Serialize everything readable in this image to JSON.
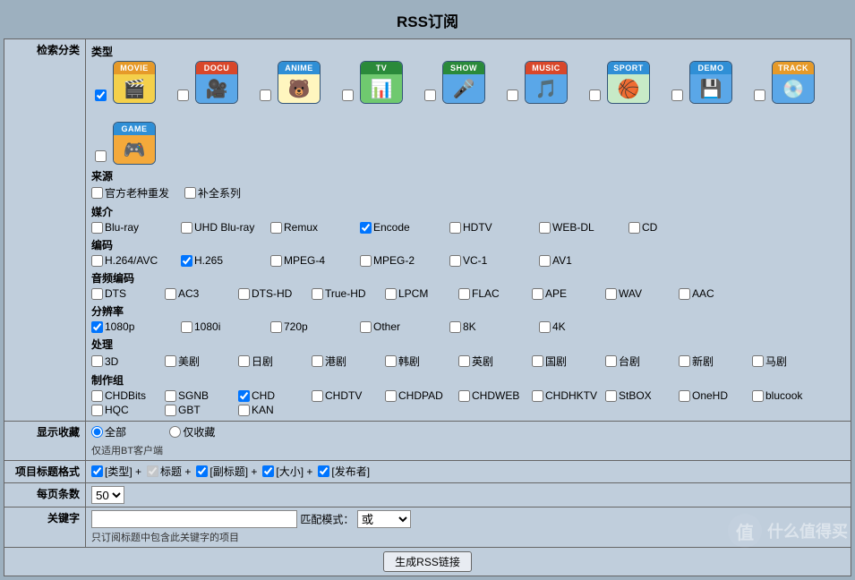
{
  "title": "RSS订阅",
  "labels": {
    "search_cat": "检索分类",
    "show_fav": "显示收藏",
    "title_fmt": "项目标题格式",
    "per_page": "每页条数",
    "keyword": "关键字"
  },
  "heads": {
    "type": "类型",
    "source": "来源",
    "media": "媒介",
    "codec": "编码",
    "audio": "音频编码",
    "res": "分辨率",
    "process": "处理",
    "team": "制作组"
  },
  "categories": [
    {
      "label": "MOVIE",
      "banner": "#e69a29",
      "bg": "#f4d04b",
      "glyph": "🎬",
      "checked": true
    },
    {
      "label": "DOCU",
      "banner": "#d9472a",
      "bg": "#5aa7e8",
      "glyph": "🎥",
      "checked": false
    },
    {
      "label": "ANIME",
      "banner": "#2f8fd6",
      "bg": "#fff6bf",
      "glyph": "🐻",
      "checked": false
    },
    {
      "label": "TV",
      "banner": "#2a8a3a",
      "bg": "#6fc96f",
      "glyph": "📊",
      "checked": false
    },
    {
      "label": "SHOW",
      "banner": "#2a8a3a",
      "bg": "#5aa7e8",
      "glyph": "🎤",
      "checked": false
    },
    {
      "label": "MUSIC",
      "banner": "#d9472a",
      "bg": "#5aa7e8",
      "glyph": "🎵",
      "checked": false
    },
    {
      "label": "SPORT",
      "banner": "#2f8fd6",
      "bg": "#c7eac7",
      "glyph": "🏀",
      "checked": false
    },
    {
      "label": "DEMO",
      "banner": "#2f8fd6",
      "bg": "#5aa7e8",
      "glyph": "💾",
      "checked": false
    },
    {
      "label": "TRACK",
      "banner": "#e69a29",
      "bg": "#5aa7e8",
      "glyph": "💿",
      "checked": false
    },
    {
      "label": "GAME",
      "banner": "#2f8fd6",
      "bg": "#f4a93b",
      "glyph": "🎮",
      "checked": false
    }
  ],
  "source": [
    {
      "label": "官方老种重发",
      "checked": false
    },
    {
      "label": "补全系列",
      "checked": false
    }
  ],
  "media": [
    {
      "label": "Blu-ray",
      "checked": false
    },
    {
      "label": "UHD Blu-ray",
      "checked": false
    },
    {
      "label": "Remux",
      "checked": false
    },
    {
      "label": "Encode",
      "checked": true
    },
    {
      "label": "HDTV",
      "checked": false
    },
    {
      "label": "WEB-DL",
      "checked": false
    },
    {
      "label": "CD",
      "checked": false
    }
  ],
  "codec": [
    {
      "label": "H.264/AVC",
      "checked": false
    },
    {
      "label": "H.265",
      "checked": true
    },
    {
      "label": "MPEG-4",
      "checked": false
    },
    {
      "label": "MPEG-2",
      "checked": false
    },
    {
      "label": "VC-1",
      "checked": false
    },
    {
      "label": "AV1",
      "checked": false
    }
  ],
  "audio": [
    {
      "label": "DTS",
      "checked": false
    },
    {
      "label": "AC3",
      "checked": false
    },
    {
      "label": "DTS-HD",
      "checked": false
    },
    {
      "label": "True-HD",
      "checked": false
    },
    {
      "label": "LPCM",
      "checked": false
    },
    {
      "label": "FLAC",
      "checked": false
    },
    {
      "label": "APE",
      "checked": false
    },
    {
      "label": "WAV",
      "checked": false
    },
    {
      "label": "AAC",
      "checked": false
    }
  ],
  "res": [
    {
      "label": "1080p",
      "checked": true
    },
    {
      "label": "1080i",
      "checked": false
    },
    {
      "label": "720p",
      "checked": false
    },
    {
      "label": "Other",
      "checked": false
    },
    {
      "label": "8K",
      "checked": false
    },
    {
      "label": "4K",
      "checked": false
    }
  ],
  "process": [
    {
      "label": "3D",
      "checked": false
    },
    {
      "label": "美剧",
      "checked": false
    },
    {
      "label": "日剧",
      "checked": false
    },
    {
      "label": "港剧",
      "checked": false
    },
    {
      "label": "韩剧",
      "checked": false
    },
    {
      "label": "英剧",
      "checked": false
    },
    {
      "label": "国剧",
      "checked": false
    },
    {
      "label": "台剧",
      "checked": false
    },
    {
      "label": "新剧",
      "checked": false
    },
    {
      "label": "马剧",
      "checked": false
    }
  ],
  "team": [
    {
      "label": "CHDBits",
      "checked": false
    },
    {
      "label": "SGNB",
      "checked": false
    },
    {
      "label": "CHD",
      "checked": true
    },
    {
      "label": "CHDTV",
      "checked": false
    },
    {
      "label": "CHDPAD",
      "checked": false
    },
    {
      "label": "CHDWEB",
      "checked": false
    },
    {
      "label": "CHDHKTV",
      "checked": false
    },
    {
      "label": "StBOX",
      "checked": false
    },
    {
      "label": "OneHD",
      "checked": false
    },
    {
      "label": "blucook",
      "checked": false
    },
    {
      "label": "HQC",
      "checked": false
    },
    {
      "label": "GBT",
      "checked": false
    },
    {
      "label": "KAN",
      "checked": false
    }
  ],
  "fav": {
    "all": "全部",
    "only": "仅收藏",
    "note": "仅适用BT客户端",
    "all_checked": true
  },
  "title_fmt": [
    {
      "label": "[类型]",
      "plus": "+",
      "checked": true,
      "disabled": false
    },
    {
      "label": "标题",
      "plus": "+",
      "checked": true,
      "disabled": true
    },
    {
      "label": "[副标题]",
      "plus": "+",
      "checked": true,
      "disabled": false
    },
    {
      "label": "[大小]",
      "plus": "+",
      "checked": true,
      "disabled": false
    },
    {
      "label": "[发布者]",
      "plus": "",
      "checked": true,
      "disabled": false
    }
  ],
  "per_page_options": [
    "50"
  ],
  "per_page_selected": "50",
  "keyword": {
    "match_label": "匹配模式：",
    "mode": "或",
    "note": "只订阅标题中包含此关键字的项目"
  },
  "submit": "生成RSS链接",
  "watermark": "什么值得买"
}
